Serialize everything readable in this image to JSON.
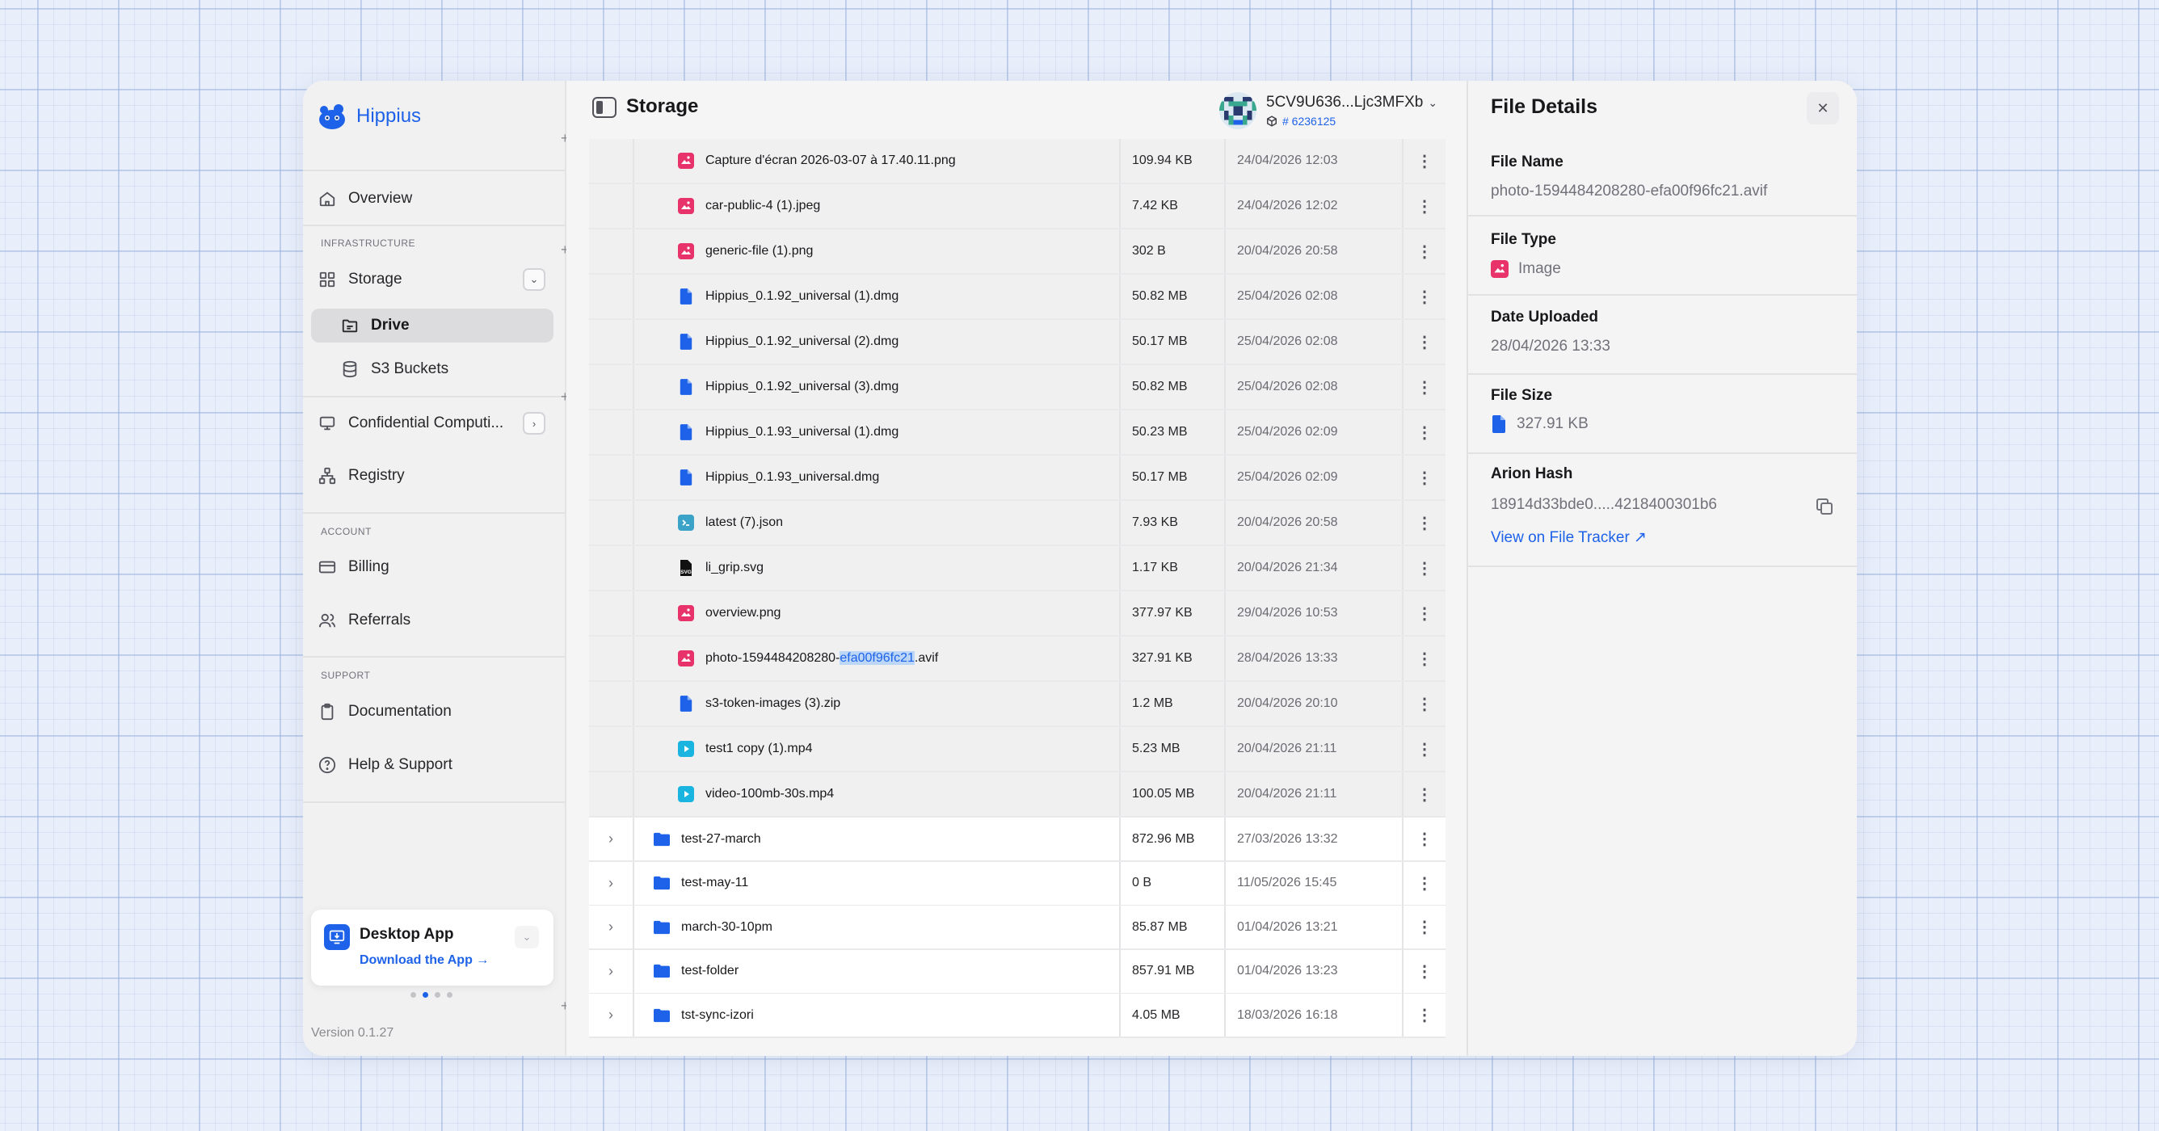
{
  "app": {
    "name": "Hippius",
    "version": "Version 0.1.27"
  },
  "sidebar": {
    "overview": "Overview",
    "section_infrastructure": "INFRASTRUCTURE",
    "storage": "Storage",
    "drive": "Drive",
    "s3_buckets": "S3 Buckets",
    "confidential": "Confidential Computi...",
    "registry": "Registry",
    "section_account": "ACCOUNT",
    "billing": "Billing",
    "referrals": "Referrals",
    "section_support": "SUPPORT",
    "documentation": "Documentation",
    "help": "Help & Support"
  },
  "desktop_card": {
    "title": "Desktop App",
    "link": "Download the App"
  },
  "header": {
    "title": "Storage",
    "wallet_address": "5CV9U636...Ljc3MFXb",
    "account_id": "# 6236125"
  },
  "files": [
    {
      "name": "Capture d'écran 2026-03-07 à 17.40.11.png",
      "size": "109.94 KB",
      "date": "24/04/2026 12:03",
      "icon": "image-icon"
    },
    {
      "name": "car-public-4 (1).jpeg",
      "size": "7.42 KB",
      "date": "24/04/2026 12:02",
      "icon": "image-icon"
    },
    {
      "name": "generic-file (1).png",
      "size": "302 B",
      "date": "20/04/2026 20:58",
      "icon": "image-icon"
    },
    {
      "name": "Hippius_0.1.92_universal (1).dmg",
      "size": "50.82 MB",
      "date": "25/04/2026 02:08",
      "icon": "document-icon"
    },
    {
      "name": "Hippius_0.1.92_universal (2).dmg",
      "size": "50.17 MB",
      "date": "25/04/2026 02:08",
      "icon": "document-icon"
    },
    {
      "name": "Hippius_0.1.92_universal (3).dmg",
      "size": "50.82 MB",
      "date": "25/04/2026 02:08",
      "icon": "document-icon"
    },
    {
      "name": "Hippius_0.1.93_universal (1).dmg",
      "size": "50.23 MB",
      "date": "25/04/2026 02:09",
      "icon": "document-icon"
    },
    {
      "name": "Hippius_0.1.93_universal.dmg",
      "size": "50.17 MB",
      "date": "25/04/2026 02:09",
      "icon": "document-icon"
    },
    {
      "name": "latest (7).json",
      "size": "7.93 KB",
      "date": "20/04/2026 20:58",
      "icon": "code-icon"
    },
    {
      "name": "li_grip.svg",
      "size": "1.17 KB",
      "date": "20/04/2026 21:34",
      "icon": "svg-icon"
    },
    {
      "name": "overview.png",
      "size": "377.97 KB",
      "date": "29/04/2026 10:53",
      "icon": "image-icon"
    },
    {
      "name_pre": "photo-1594484208280-",
      "name_hl": "efa00f96fc21",
      "name_post": ".avif",
      "size": "327.91 KB",
      "date": "28/04/2026 13:33",
      "icon": "image-icon"
    },
    {
      "name": "s3-token-images (3).zip",
      "size": "1.2 MB",
      "date": "20/04/2026 20:10",
      "icon": "document-icon"
    },
    {
      "name": "test1 copy (1).mp4",
      "size": "5.23 MB",
      "date": "20/04/2026 21:11",
      "icon": "video-icon"
    },
    {
      "name": "video-100mb-30s.mp4",
      "size": "100.05 MB",
      "date": "20/04/2026 21:11",
      "icon": "video-icon"
    }
  ],
  "folders": [
    {
      "name": "test-27-march",
      "size": "872.96 MB",
      "date": "27/03/2026 13:32"
    },
    {
      "name": "test-may-11",
      "size": "0 B",
      "date": "11/05/2026 15:45"
    },
    {
      "name": "march-30-10pm",
      "size": "85.87 MB",
      "date": "01/04/2026 13:21"
    },
    {
      "name": "test-folder",
      "size": "857.91 MB",
      "date": "01/04/2026 13:23"
    },
    {
      "name": "tst-sync-izori",
      "size": "4.05 MB",
      "date": "18/03/2026 16:18"
    }
  ],
  "details": {
    "title": "File Details",
    "file_name_label": "File Name",
    "file_name": "photo-1594484208280-efa00f96fc21.avif",
    "file_type_label": "File Type",
    "file_type": "Image",
    "date_label": "Date Uploaded",
    "date": "28/04/2026 13:33",
    "size_label": "File Size",
    "size": "327.91 KB",
    "hash_label": "Arion Hash",
    "hash": "18914d33bde0.....4218400301b6",
    "tracker_link": "View on File Tracker ↗"
  },
  "colors": {
    "accent": "#1d62e8",
    "image_icon": "#e8336a",
    "video_icon": "#1ab4e0",
    "code_icon": "#3ba3c8"
  }
}
